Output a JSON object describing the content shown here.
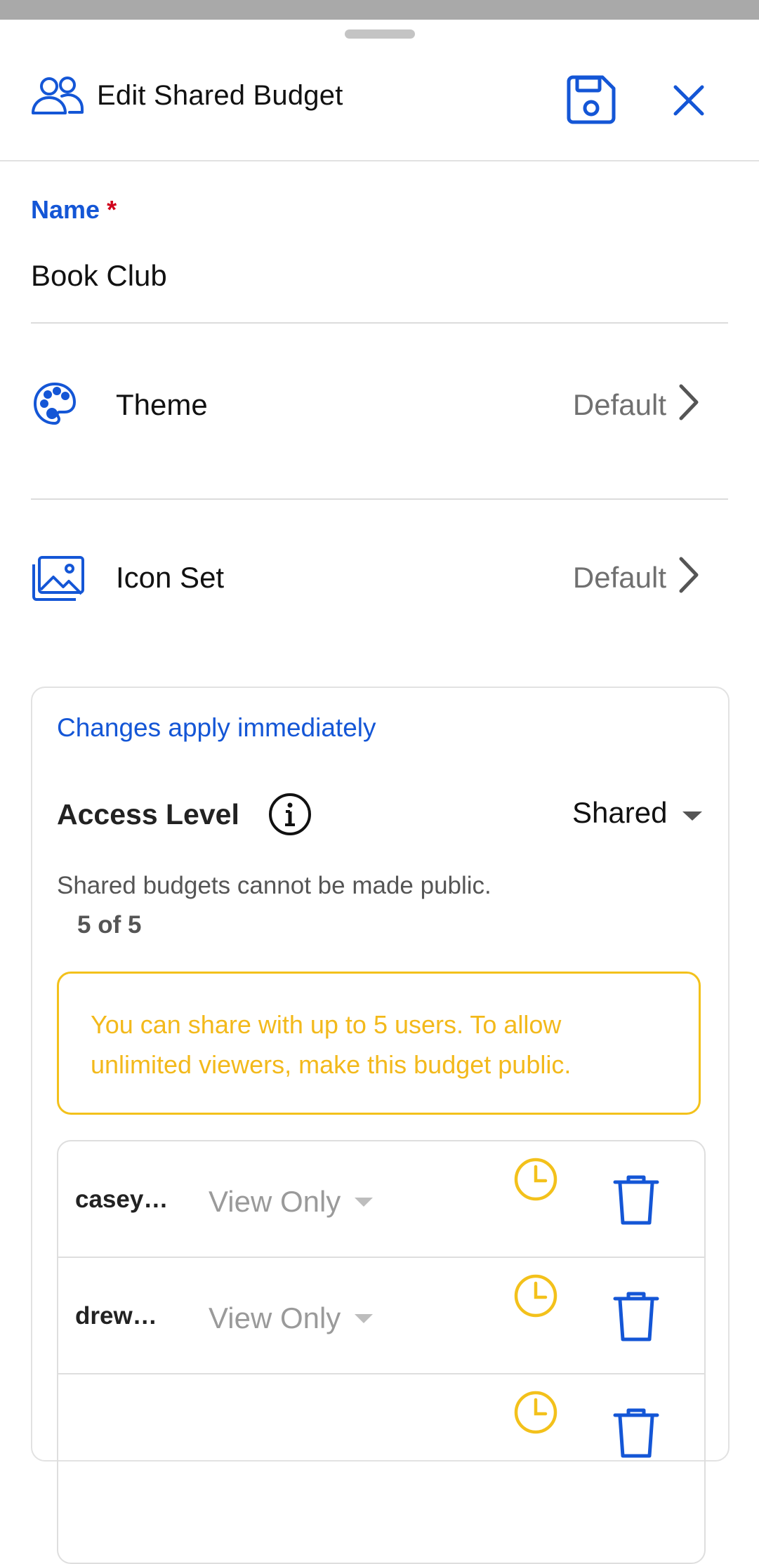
{
  "header": {
    "title": "Edit Shared Budget",
    "icons": {
      "leading": "people-icon",
      "save": "save-icon",
      "close": "close-icon"
    }
  },
  "form": {
    "name_label": "Name",
    "required_mark": "*",
    "name_value": "Book Club"
  },
  "settings": [
    {
      "label": "Theme",
      "value": "Default",
      "icon": "palette-icon"
    },
    {
      "label": "Icon Set",
      "value": "Default",
      "icon": "image-icon"
    }
  ],
  "sharing": {
    "changes_notice": "Changes apply immediately",
    "access_label": "Access Level",
    "access_value": "Shared",
    "note": "Shared budgets cannot be made public.",
    "count": "5 of 5",
    "warning": "You can share with up to 5 users. To allow unlimited viewers, make this budget public.",
    "users": [
      {
        "name": "casey…",
        "permission": "View Only"
      },
      {
        "name": "drew…",
        "permission": "View Only"
      },
      {
        "name": "",
        "permission": ""
      }
    ]
  },
  "colors": {
    "accent": "#1456d6",
    "warning": "#f3c11b",
    "required": "#d0021b"
  }
}
